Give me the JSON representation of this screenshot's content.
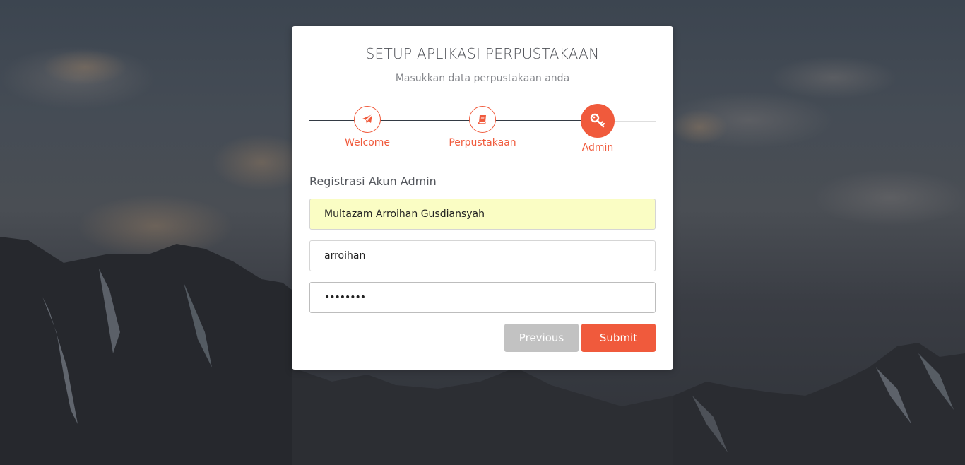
{
  "header": {
    "title": "SETUP APLIKASI PERPUSTAKAAN",
    "subtitle": "Masukkan data perpustakaan anda"
  },
  "wizard": {
    "steps": [
      {
        "label": "Welcome",
        "icon": "paper-plane-icon",
        "state": "completed"
      },
      {
        "label": "Perpustakaan",
        "icon": "book-icon",
        "state": "completed"
      },
      {
        "label": "Admin",
        "icon": "key-icon",
        "state": "active"
      }
    ],
    "accent_color": "#f05a3c"
  },
  "form": {
    "section_label": "Registrasi Akun Admin",
    "fullname_value": "Multazam Arroihan Gusdiansyah",
    "username_value": "arroihan",
    "password_value": "••••••••"
  },
  "buttons": {
    "previous_label": "Previous",
    "submit_label": "Submit"
  }
}
